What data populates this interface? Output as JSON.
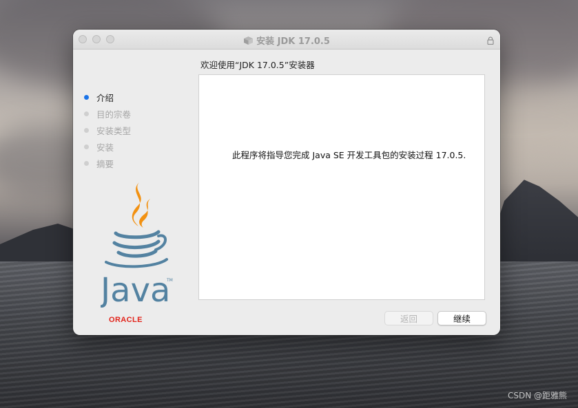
{
  "window": {
    "title": "安装 JDK 17.0.5",
    "heading": "欢迎使用“JDK 17.0.5”安装器",
    "icons": [
      "package-icon",
      "lock-icon"
    ]
  },
  "sidebar": {
    "steps": [
      {
        "label": "介绍",
        "active": true
      },
      {
        "label": "目的宗卷",
        "active": false
      },
      {
        "label": "安装类型",
        "active": false
      },
      {
        "label": "安装",
        "active": false
      },
      {
        "label": "摘要",
        "active": false
      }
    ],
    "brand": {
      "logo": "java-logo",
      "logo_word": "Java",
      "vendor": "ORACLE",
      "vendor_color": "#e2231a"
    }
  },
  "content": {
    "message": "此程序将指导您完成 Java SE 开发工具包的安装过程 17.0.5."
  },
  "buttons": {
    "back_label": "返回",
    "continue_label": "继续"
  },
  "watermark": "CSDN @距雅熊",
  "colors": {
    "active_step": "#1a73e8"
  }
}
